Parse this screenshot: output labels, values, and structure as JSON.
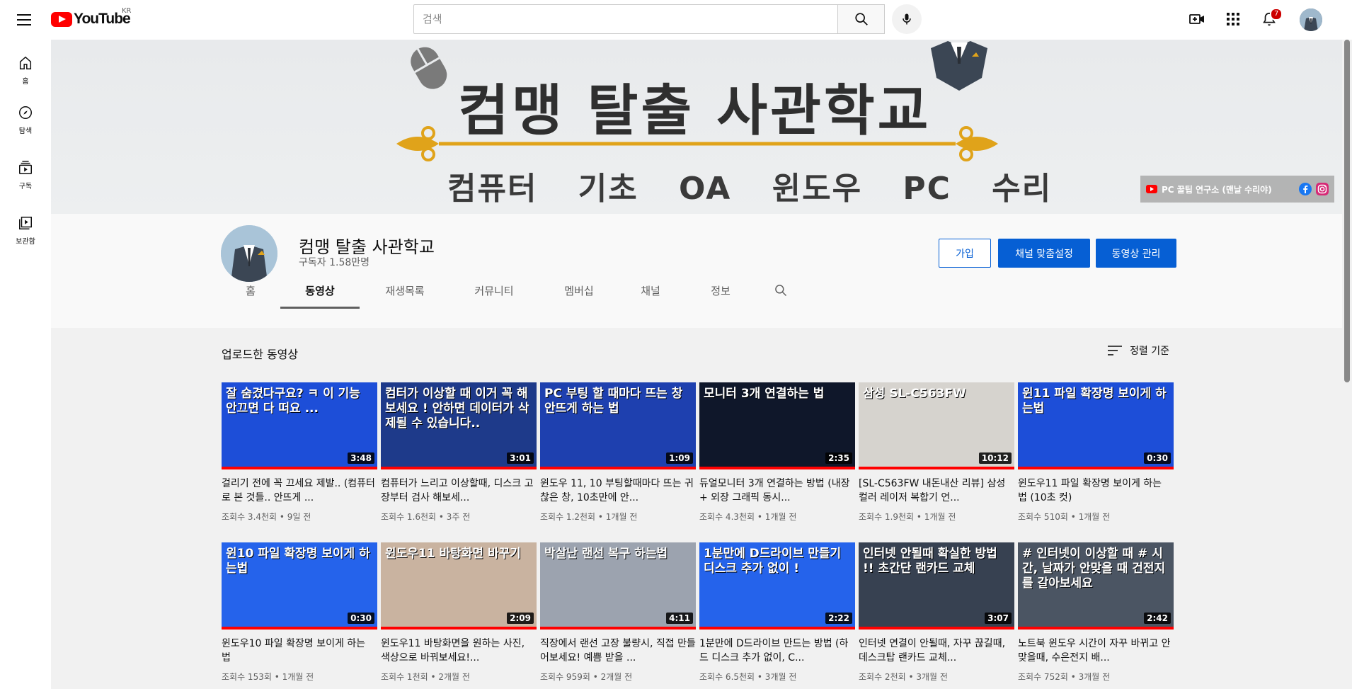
{
  "topbar": {
    "logo_text": "YouTube",
    "country": "KR",
    "search_placeholder": "검색",
    "notification_count": "7"
  },
  "leftnav": {
    "items": [
      {
        "label": "홈",
        "icon": "home-icon"
      },
      {
        "label": "탐색",
        "icon": "compass-icon"
      },
      {
        "label": "구독",
        "icon": "subscriptions-icon"
      },
      {
        "label": "보관함",
        "icon": "library-icon"
      }
    ]
  },
  "banner": {
    "title": "컴맹 탈출 사관학교",
    "subtitle": "컴퓨터 기초 OA 윈도우 PC 수리",
    "link_text": "PC 꿀팁 연구소 (맨날 수리야)"
  },
  "channel": {
    "name": "컴맹 탈출 사관학교",
    "subscribers": "구독자 1.58만명",
    "join_label": "가입",
    "customize_label": "채널 맞춤설정",
    "manage_label": "동영상 관리"
  },
  "tabs": [
    {
      "label": "홈"
    },
    {
      "label": "동영상"
    },
    {
      "label": "재생목록"
    },
    {
      "label": "커뮤니티"
    },
    {
      "label": "멤버십"
    },
    {
      "label": "채널"
    },
    {
      "label": "정보"
    }
  ],
  "section": {
    "title": "업로드한 동영상",
    "sort_label": "정렬 기준"
  },
  "videos": [
    {
      "thumb_text": "잘 숨겼다구요? ㅋ 이 기능 안끄면 다 떠요 ...",
      "duration": "3:48",
      "title": "걸리기 전에 꼭 끄세요 제발.. (컴퓨터로 본 것들.. 안뜨게 ...",
      "meta": "조회수 3.4천회 • 9일 전",
      "bg": "#1d4ed8"
    },
    {
      "thumb_text": "컴터가 이상할 때 이거 꼭 해보세요 ! 안하면 데이터가 삭제될 수 있습니다..",
      "duration": "3:01",
      "title": "컴퓨터가 느리고 이상할때, 디스크 고장부터 검사 해보세...",
      "meta": "조회수 1.6천회 • 3주 전",
      "bg": "#1e3a8a"
    },
    {
      "thumb_text": "PC 부팅 할 때마다 뜨는 창 안뜨게 하는 법",
      "duration": "1:09",
      "title": "윈도우 11, 10 부팅할때마다 뜨는 귀찮은 창, 10초만에 안...",
      "meta": "조회수 1.2천회 • 1개월 전",
      "bg": "#1e40af"
    },
    {
      "thumb_text": "모니터 3개 연결하는 법",
      "duration": "2:35",
      "title": "듀얼모니터 3개 연결하는 방법 (내장 + 외장 그래픽 동시...",
      "meta": "조회수 4.3천회 • 1개월 전",
      "bg": "#0f172a"
    },
    {
      "thumb_text": "삼성 SL-C563FW",
      "duration": "10:12",
      "title": "[SL-C563FW 내돈내산 리뷰] 삼성 컬러 레이저 복합기 언...",
      "meta": "조회수 1.9천회 • 1개월 전",
      "bg": "#d6d3ce"
    },
    {
      "thumb_text": "윈11 파일 확장명 보이게 하는법",
      "duration": "0:30",
      "title": "윈도우11 파일 확장명 보이게 하는 법 (10초 컷)",
      "meta": "조회수 510회 • 1개월 전",
      "bg": "#1d4ed8"
    },
    {
      "thumb_text": "윈10 파일 확장명 보이게 하는법",
      "duration": "0:30",
      "title": "윈도우10 파일 확장명 보이게 하는 법",
      "meta": "조회수 153회 • 1개월 전",
      "bg": "#2563eb"
    },
    {
      "thumb_text": "윈도우11 바탕화면 바꾸기",
      "duration": "2:09",
      "title": "윈도우11 바탕화면을 원하는 사진, 색상으로 바꿔보세요!...",
      "meta": "조회수 1천회 • 2개월 전",
      "bg": "#c9b3a0"
    },
    {
      "thumb_text": "박살난 랜선 복구 하는법",
      "duration": "4:11",
      "title": "직장에서 랜선 고장 불량시, 직접 만들어보세요! 예쁨 받을 ...",
      "meta": "조회수 959회 • 2개월 전",
      "bg": "#9ca3af"
    },
    {
      "thumb_text": "1분만에 D드라이브 만들기 디스크 추가 없이 !",
      "duration": "2:22",
      "title": "1분만에 D드라이브 만드는 방법 (하드 디스크 추가 없이, C...",
      "meta": "조회수 6.5천회 • 3개월 전",
      "bg": "#2563eb"
    },
    {
      "thumb_text": "인터넷 안될때 확실한 방법 !! 초간단 랜카드 교체",
      "duration": "3:07",
      "title": "인터넷 연결이 안될때, 자꾸 끊길때, 데스크탑 랜카드 교체...",
      "meta": "조회수 2천회 • 3개월 전",
      "bg": "#374151"
    },
    {
      "thumb_text": "# 인터넷이 이상할 때 # 시간, 날짜가 안맞을 때 건전지를 갈아보세요",
      "duration": "2:42",
      "title": "노트북 윈도우 시간이 자꾸 바뀌고 안맞을때, 수은전지 배...",
      "meta": "조회수 752회 • 3개월 전",
      "bg": "#4b5563"
    }
  ]
}
